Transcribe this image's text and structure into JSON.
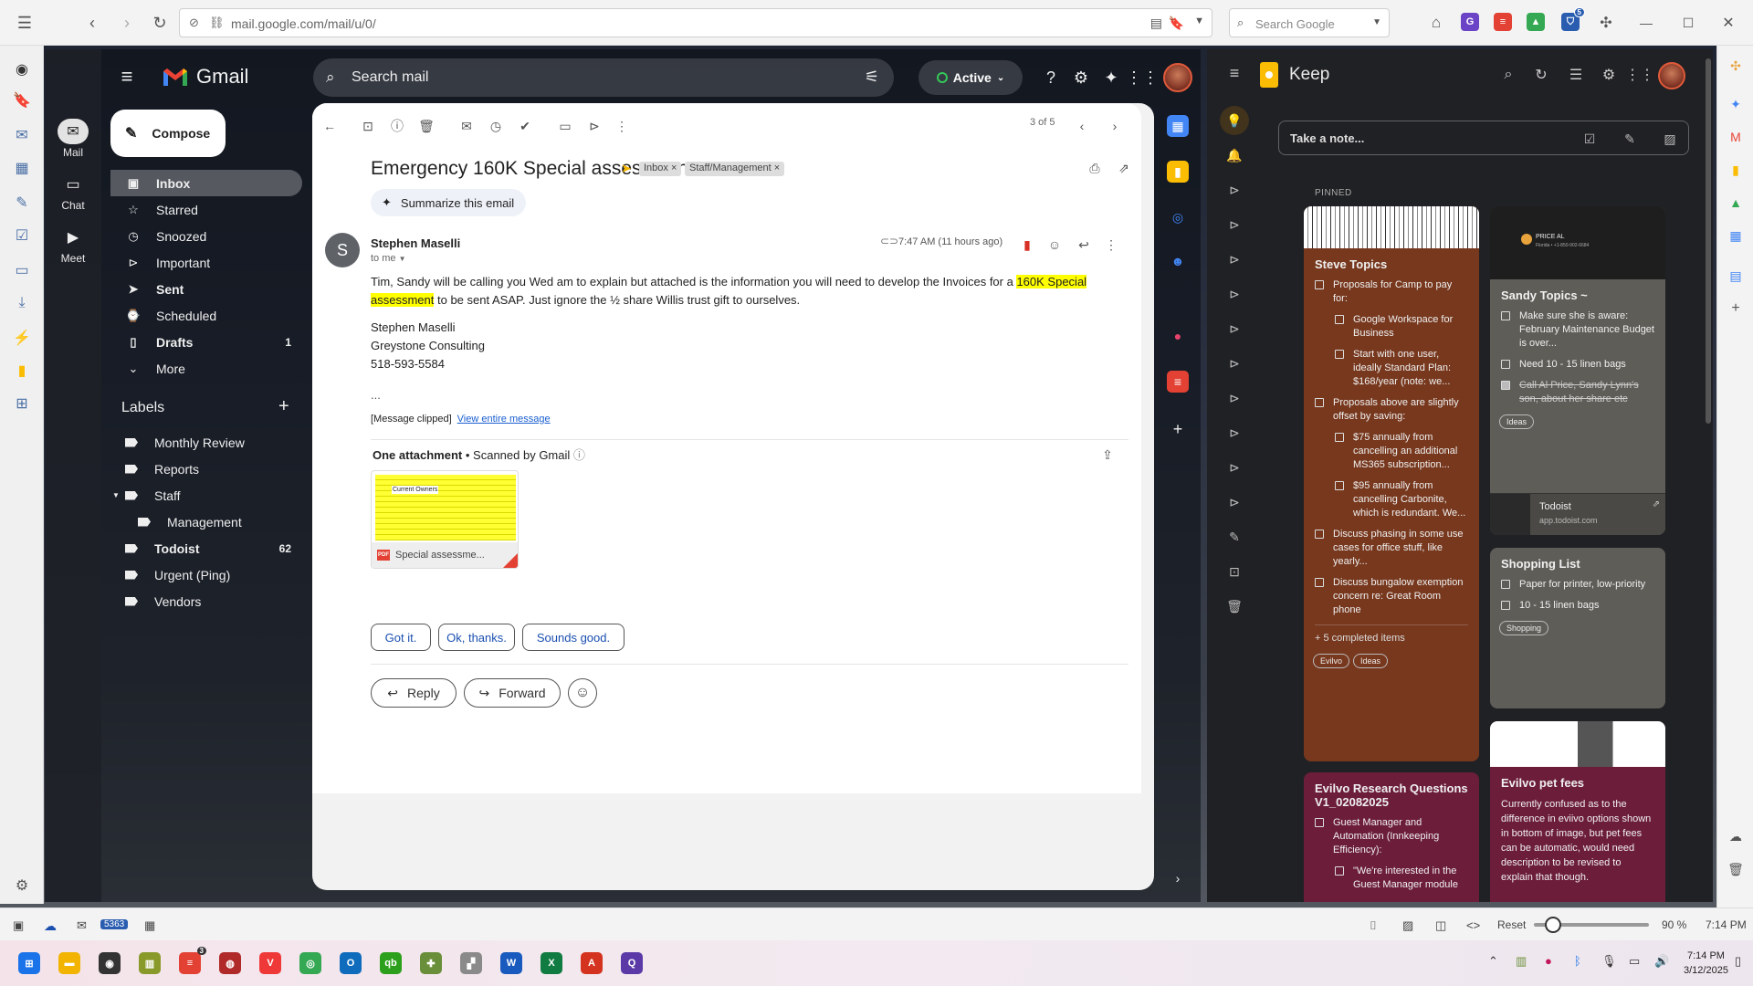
{
  "browser": {
    "url": "mail.google.com/mail/u/0/",
    "search_placeholder": "Search Google",
    "ext_badge": "5"
  },
  "gmail": {
    "logo_word": "Gmail",
    "search_placeholder": "Search mail",
    "status": "Active",
    "rail": [
      {
        "label": "Mail",
        "icon": "mail-icon"
      },
      {
        "label": "Chat",
        "icon": "chat-icon"
      },
      {
        "label": "Meet",
        "icon": "video-icon"
      }
    ],
    "compose_label": "Compose",
    "nav": [
      {
        "label": "Inbox",
        "icon": "inbox-icon",
        "count": ""
      },
      {
        "label": "Starred",
        "icon": "star-icon",
        "count": ""
      },
      {
        "label": "Snoozed",
        "icon": "clock-icon",
        "count": ""
      },
      {
        "label": "Important",
        "icon": "important-icon",
        "count": ""
      },
      {
        "label": "Sent",
        "icon": "send-icon",
        "count": ""
      },
      {
        "label": "Scheduled",
        "icon": "scheduled-icon",
        "count": ""
      },
      {
        "label": "Drafts",
        "icon": "draft-icon",
        "count": "1"
      },
      {
        "label": "More",
        "icon": "chevron-down-icon",
        "count": ""
      }
    ],
    "labels_heading": "Labels",
    "labels": [
      {
        "label": "Monthly Review",
        "count": ""
      },
      {
        "label": "Reports",
        "count": ""
      },
      {
        "label": "Staff",
        "count": ""
      },
      {
        "label": "Management",
        "count": ""
      },
      {
        "label": "Todoist",
        "count": "62"
      },
      {
        "label": "Urgent (Ping)",
        "count": ""
      },
      {
        "label": "Vendors",
        "count": ""
      }
    ],
    "pager": "3 of 5",
    "email": {
      "subject": "Emergency 160K Special assessment",
      "chips": [
        "Inbox ×",
        "Staff/Management ×"
      ],
      "summarize_label": "Summarize this email",
      "sender_initial": "S",
      "sender": "Stephen Maselli",
      "to": "to me",
      "time": "7:47 AM (11 hours ago)",
      "body_pre": "Tim, Sandy will be calling you Wed am to explain but attached is the information you will need to develop the Invoices for a ",
      "body_highlight": "160K Special assessment",
      "body_post": " to be sent ASAP.   Just ignore the ½ share Willis trust gift to ourselves.",
      "sig_name": "Stephen Maselli",
      "sig_company": "Greystone Consulting",
      "sig_phone": "518-593-5584",
      "ellipsis": "...",
      "clipped": "[Message clipped]",
      "view_entire": "View entire message",
      "attach_heading": "One attachment",
      "scanned": "Scanned by Gmail",
      "attach_name": "Special assessme...",
      "attach_thumb_title": "Current Owners",
      "smart_replies": [
        "Got it.",
        "Ok, thanks.",
        "Sounds good."
      ],
      "reply_label": "Reply",
      "forward_label": "Forward"
    }
  },
  "keep": {
    "title": "Keep",
    "take_note": "Take a note...",
    "pinned": "PINNED",
    "notes": {
      "steve": {
        "title": "Steve Topics",
        "items": [
          "Proposals for Camp to pay for:",
          "Google Workspace for Business",
          "Start with one user, ideally Standard Plan: $168/year (note: we...",
          "Proposals above are slightly offset by saving:",
          "$75 annually from cancelling an additional MS365 subscription...",
          "$95 annually from cancelling Carbonite, which is redundant. We...",
          "Discuss phasing in some use cases for office stuff, like yearly...",
          "Discuss bungalow exemption concern re: Great Room phone"
        ],
        "completed": "+ 5 completed items",
        "tags": [
          "Evilvo",
          "Ideas"
        ]
      },
      "sandy": {
        "title": "Sandy Topics ~",
        "items": [
          "Make sure she is aware: February Maintenance Budget is over...",
          "Need 10 - 15 linen bags",
          "Call Al Price, Sandy Lynn's son, about her share etc"
        ],
        "tags": [
          "Ideas"
        ],
        "link_title": "Todoist",
        "link_url": "app.todoist.com",
        "phone_name": "PRICE AL",
        "phone_detail": "Florida • +1-850-902-6684"
      },
      "shopping": {
        "title": "Shopping List",
        "items": [
          "Paper for printer, low-priority",
          "10 - 15 linen bags"
        ],
        "tags": [
          "Shopping"
        ]
      },
      "evilvo_research": {
        "title": "Evilvo Research Questions V1_02082025",
        "items": [
          "Guest Manager and Automation (Innkeeping Efficiency):",
          "\"We're interested in the Guest Manager module"
        ]
      },
      "pet_fees": {
        "title": "Evilvo pet fees",
        "body": "Currently confused as to the difference in eviivo options shown in bottom of image, but pet fees can be automatic, would need description to be revised to explain that though."
      }
    }
  },
  "statusbar": {
    "badge": "5363",
    "reset": "Reset",
    "zoom": "90 %",
    "time": "7:14 PM"
  },
  "taskbar": {
    "badge": "3",
    "time": "7:14 PM",
    "date": "3/12/2025"
  },
  "colors": {
    "keep_brown": "#77381e",
    "keep_gray": "#5f5d58",
    "keep_wine": "#6c1d3a",
    "highlight": "#ffff00",
    "link": "#1a5fd0"
  }
}
